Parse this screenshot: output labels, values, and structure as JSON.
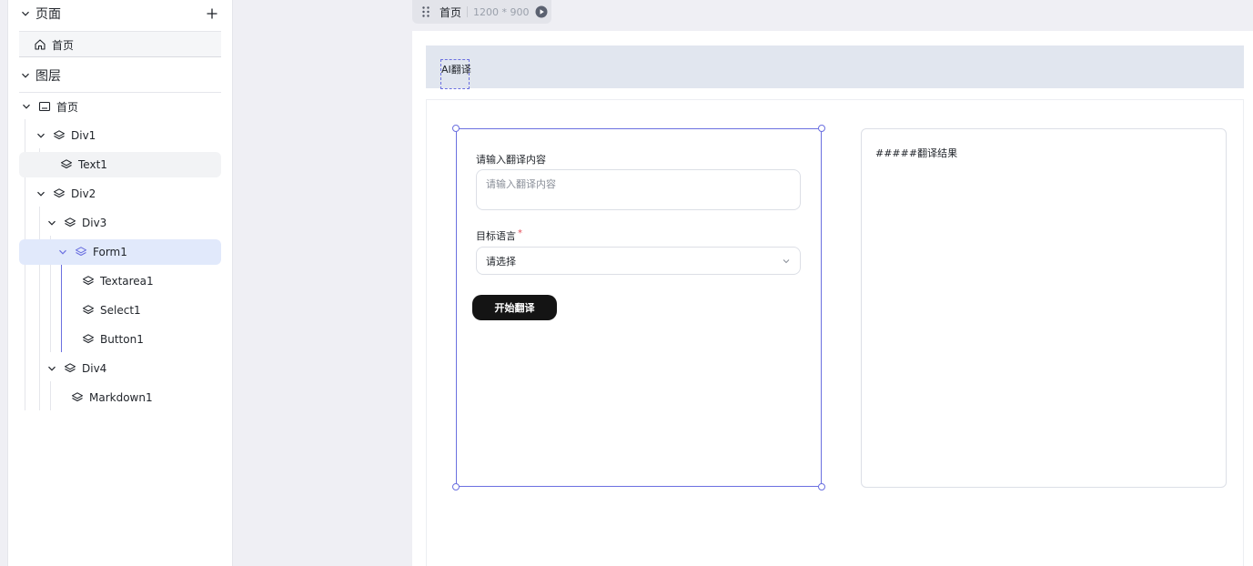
{
  "sidebar": {
    "pages_section": {
      "title": "页面",
      "items": [
        {
          "label": "首页"
        }
      ]
    },
    "layers_section": {
      "title": "图层"
    },
    "tree": [
      {
        "label": "首页"
      },
      {
        "label": "Div1"
      },
      {
        "label": "Text1"
      },
      {
        "label": "Div2"
      },
      {
        "label": "Div3"
      },
      {
        "label": "Form1"
      },
      {
        "label": "Textarea1"
      },
      {
        "label": "Select1"
      },
      {
        "label": "Button1"
      },
      {
        "label": "Div4"
      },
      {
        "label": "Markdown1"
      }
    ]
  },
  "canvas": {
    "page_name": "首页",
    "size_label": "1200 * 900",
    "title_text": "AI翻译",
    "form": {
      "input_label": "请输入翻译内容",
      "input_placeholder": "请输入翻译内容",
      "input_value": "",
      "language_label": "目标语言",
      "required_mark": "*",
      "language_selected": "请选择",
      "submit_label": "开始翻译"
    },
    "result_markdown": "#####翻译结果"
  },
  "colors": {
    "accent": "#6b70e0",
    "selected_row": "#e1e9fb",
    "header_bar": "#e1e6ef",
    "button": "#141414",
    "required": "#e34d59"
  }
}
